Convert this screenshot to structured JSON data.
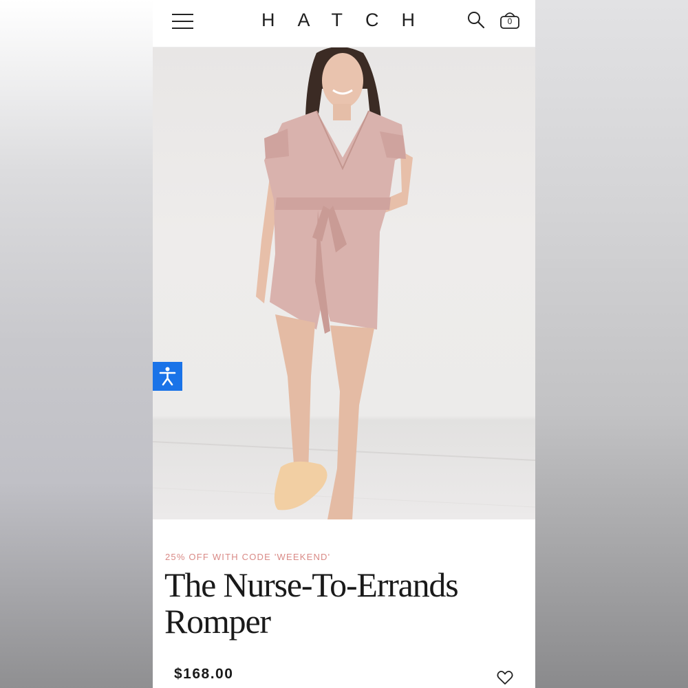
{
  "header": {
    "brand": "HATCH",
    "menu_icon": "hamburger-menu-icon",
    "search_icon": "search-icon",
    "cart_icon": "shopping-basket-icon",
    "cart_count": "0"
  },
  "hero": {
    "image_subject": "woman wearing blush pink belted romper with slippers",
    "romper_color": "#d9b2ad"
  },
  "accessibility": {
    "icon": "accessibility-person-icon",
    "color": "#1a73e8"
  },
  "product": {
    "promo_text": "25% OFF WITH CODE 'WEEKEND'",
    "promo_color": "#d98a86",
    "title": "The Nurse-To-Errands Romper",
    "price": "$168.00",
    "wishlist_icon": "heart-outline-icon"
  }
}
